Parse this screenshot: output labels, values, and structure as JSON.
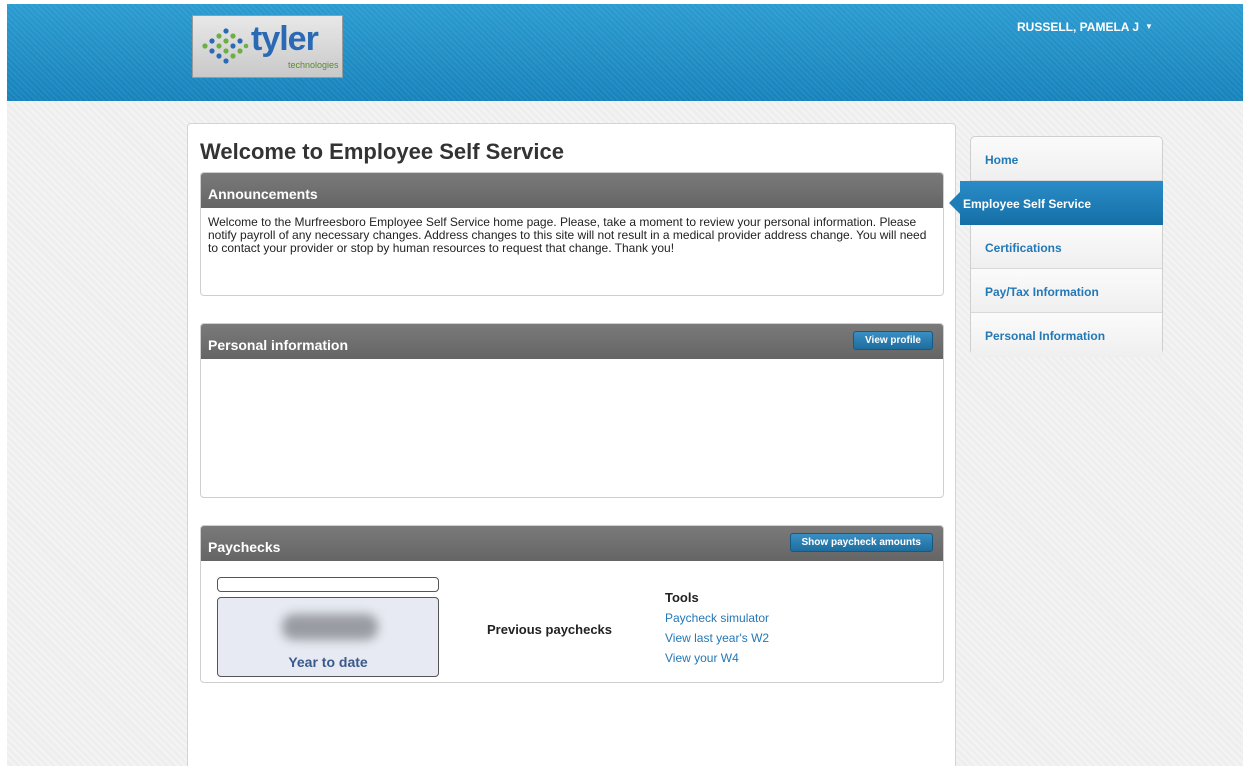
{
  "header": {
    "logo_word": "tyler",
    "logo_sub": "technologies",
    "user_name": "RUSSELL, PAMELA J",
    "user_caret": "▼"
  },
  "page": {
    "title": "Welcome to Employee Self Service"
  },
  "announcements": {
    "title": "Announcements",
    "text": "Welcome to the Murfreesboro Employee Self Service home page. Please, take a moment to review your personal information. Please notify payroll of any necessary changes. Address changes to this site will not result in a medical provider address change. You will need to contact your provider or stop by human resources to request that change. Thank you!"
  },
  "personal": {
    "title": "Personal information",
    "button": "View profile"
  },
  "paychecks": {
    "title": "Paychecks",
    "button": "Show paycheck amounts",
    "ytd_label": "Year to date",
    "previous_label": "Previous paychecks",
    "tools_title": "Tools",
    "tools": [
      "Paycheck simulator",
      "View last year's W2",
      "View your W4"
    ]
  },
  "sidenav": {
    "items": [
      {
        "label": "Home",
        "active": false
      },
      {
        "label": "Employee Self Service",
        "active": true
      },
      {
        "label": "Certifications",
        "active": false
      },
      {
        "label": "Pay/Tax Information",
        "active": false
      },
      {
        "label": "Personal Information",
        "active": false
      }
    ]
  },
  "colors": {
    "header_blue": "#1b8fc6",
    "link_blue": "#2378b6",
    "panel_header_gray": "#6e6e6e",
    "button_blue": "#1e6d9f"
  }
}
